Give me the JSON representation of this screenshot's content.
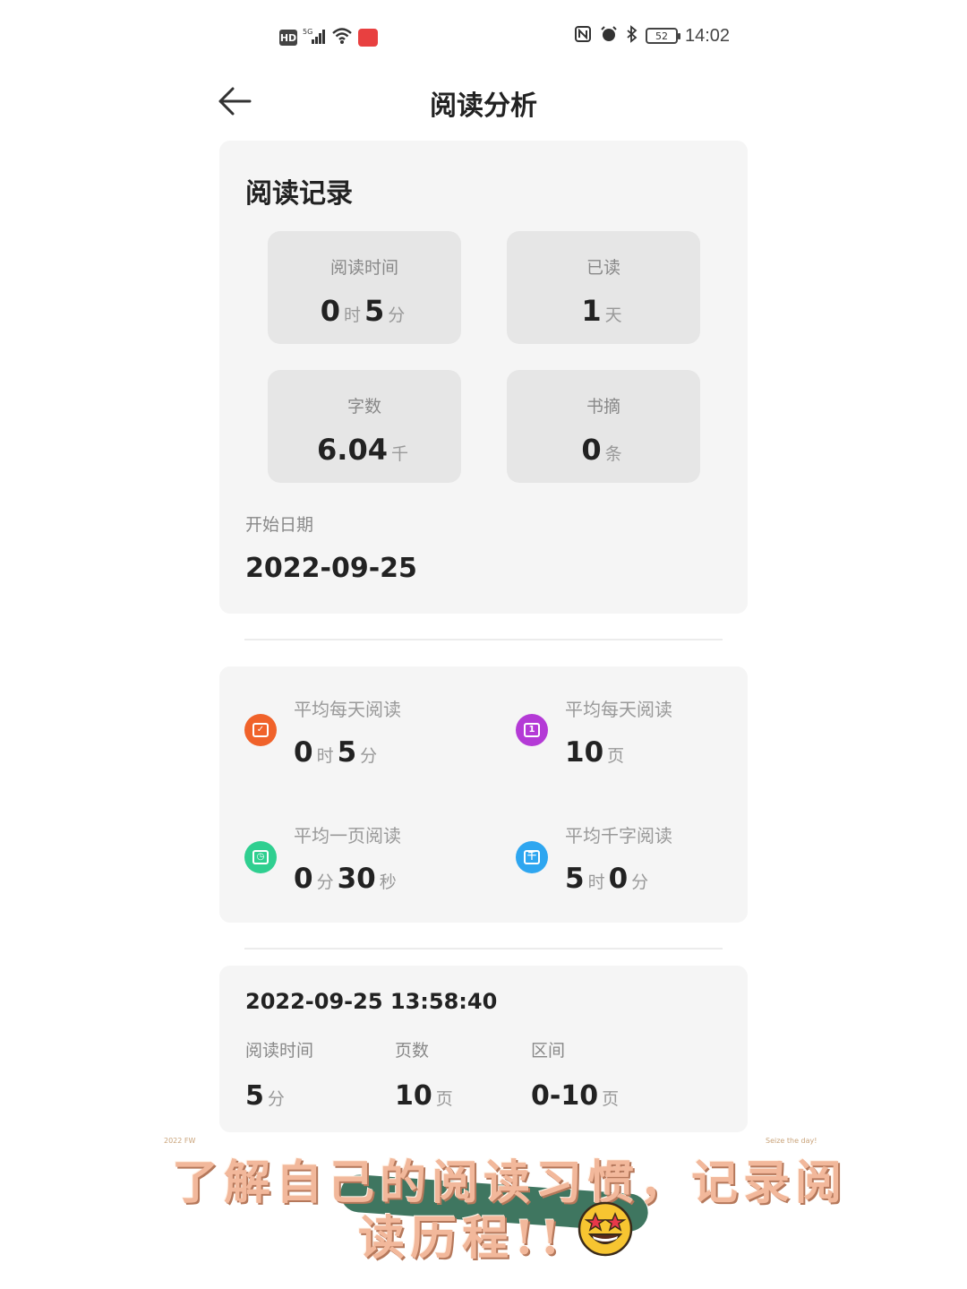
{
  "status_bar": {
    "hd": "HD",
    "network": "5G",
    "battery": "52",
    "time": "14:02"
  },
  "nav": {
    "title": "阅读分析"
  },
  "reading_record": {
    "title": "阅读记录",
    "tiles": [
      {
        "label": "阅读时间",
        "parts": [
          {
            "num": "0",
            "unit": "时"
          },
          {
            "num": "5",
            "unit": "分"
          }
        ]
      },
      {
        "label": "已读",
        "parts": [
          {
            "num": "1",
            "unit": "天"
          }
        ]
      },
      {
        "label": "字数",
        "parts": [
          {
            "num": "6.04",
            "unit": "千"
          }
        ]
      },
      {
        "label": "书摘",
        "parts": [
          {
            "num": "0",
            "unit": "条"
          }
        ]
      }
    ],
    "start_label": "开始日期",
    "start_value": "2022-09-25"
  },
  "averages": {
    "colors": {
      "orange": "#f0622a",
      "purple": "#b43ad6",
      "green": "#2fcf90",
      "blue": "#2ea6f0"
    },
    "items": [
      {
        "label": "平均每天阅读",
        "icon": "calendar-check-icon",
        "parts": [
          {
            "num": "0",
            "unit": "时"
          },
          {
            "num": "5",
            "unit": "分"
          }
        ]
      },
      {
        "label": "平均每天阅读",
        "icon": "calendar-day-icon",
        "parts": [
          {
            "num": "10",
            "unit": "页"
          }
        ]
      },
      {
        "label": "平均一页阅读",
        "icon": "page-clock-icon",
        "parts": [
          {
            "num": "0",
            "unit": "分"
          },
          {
            "num": "30",
            "unit": "秒"
          }
        ]
      },
      {
        "label": "平均千字阅读",
        "icon": "thousand-words-icon",
        "parts": [
          {
            "num": "5",
            "unit": "时"
          },
          {
            "num": "0",
            "unit": "分"
          }
        ]
      }
    ]
  },
  "record": {
    "datetime": "2022-09-25 13:58:40",
    "columns": [
      {
        "label": "阅读时间",
        "num": "5",
        "unit": "分"
      },
      {
        "label": "页数",
        "num": "10",
        "unit": "页"
      },
      {
        "label": "区间",
        "num": "0-10",
        "unit": "页"
      }
    ]
  },
  "overlay": {
    "corner_left": "2022 FW",
    "corner_right": "Seize the day!",
    "line1": "了解自己的阅读习惯，记录阅",
    "line2": "读历程!!"
  }
}
